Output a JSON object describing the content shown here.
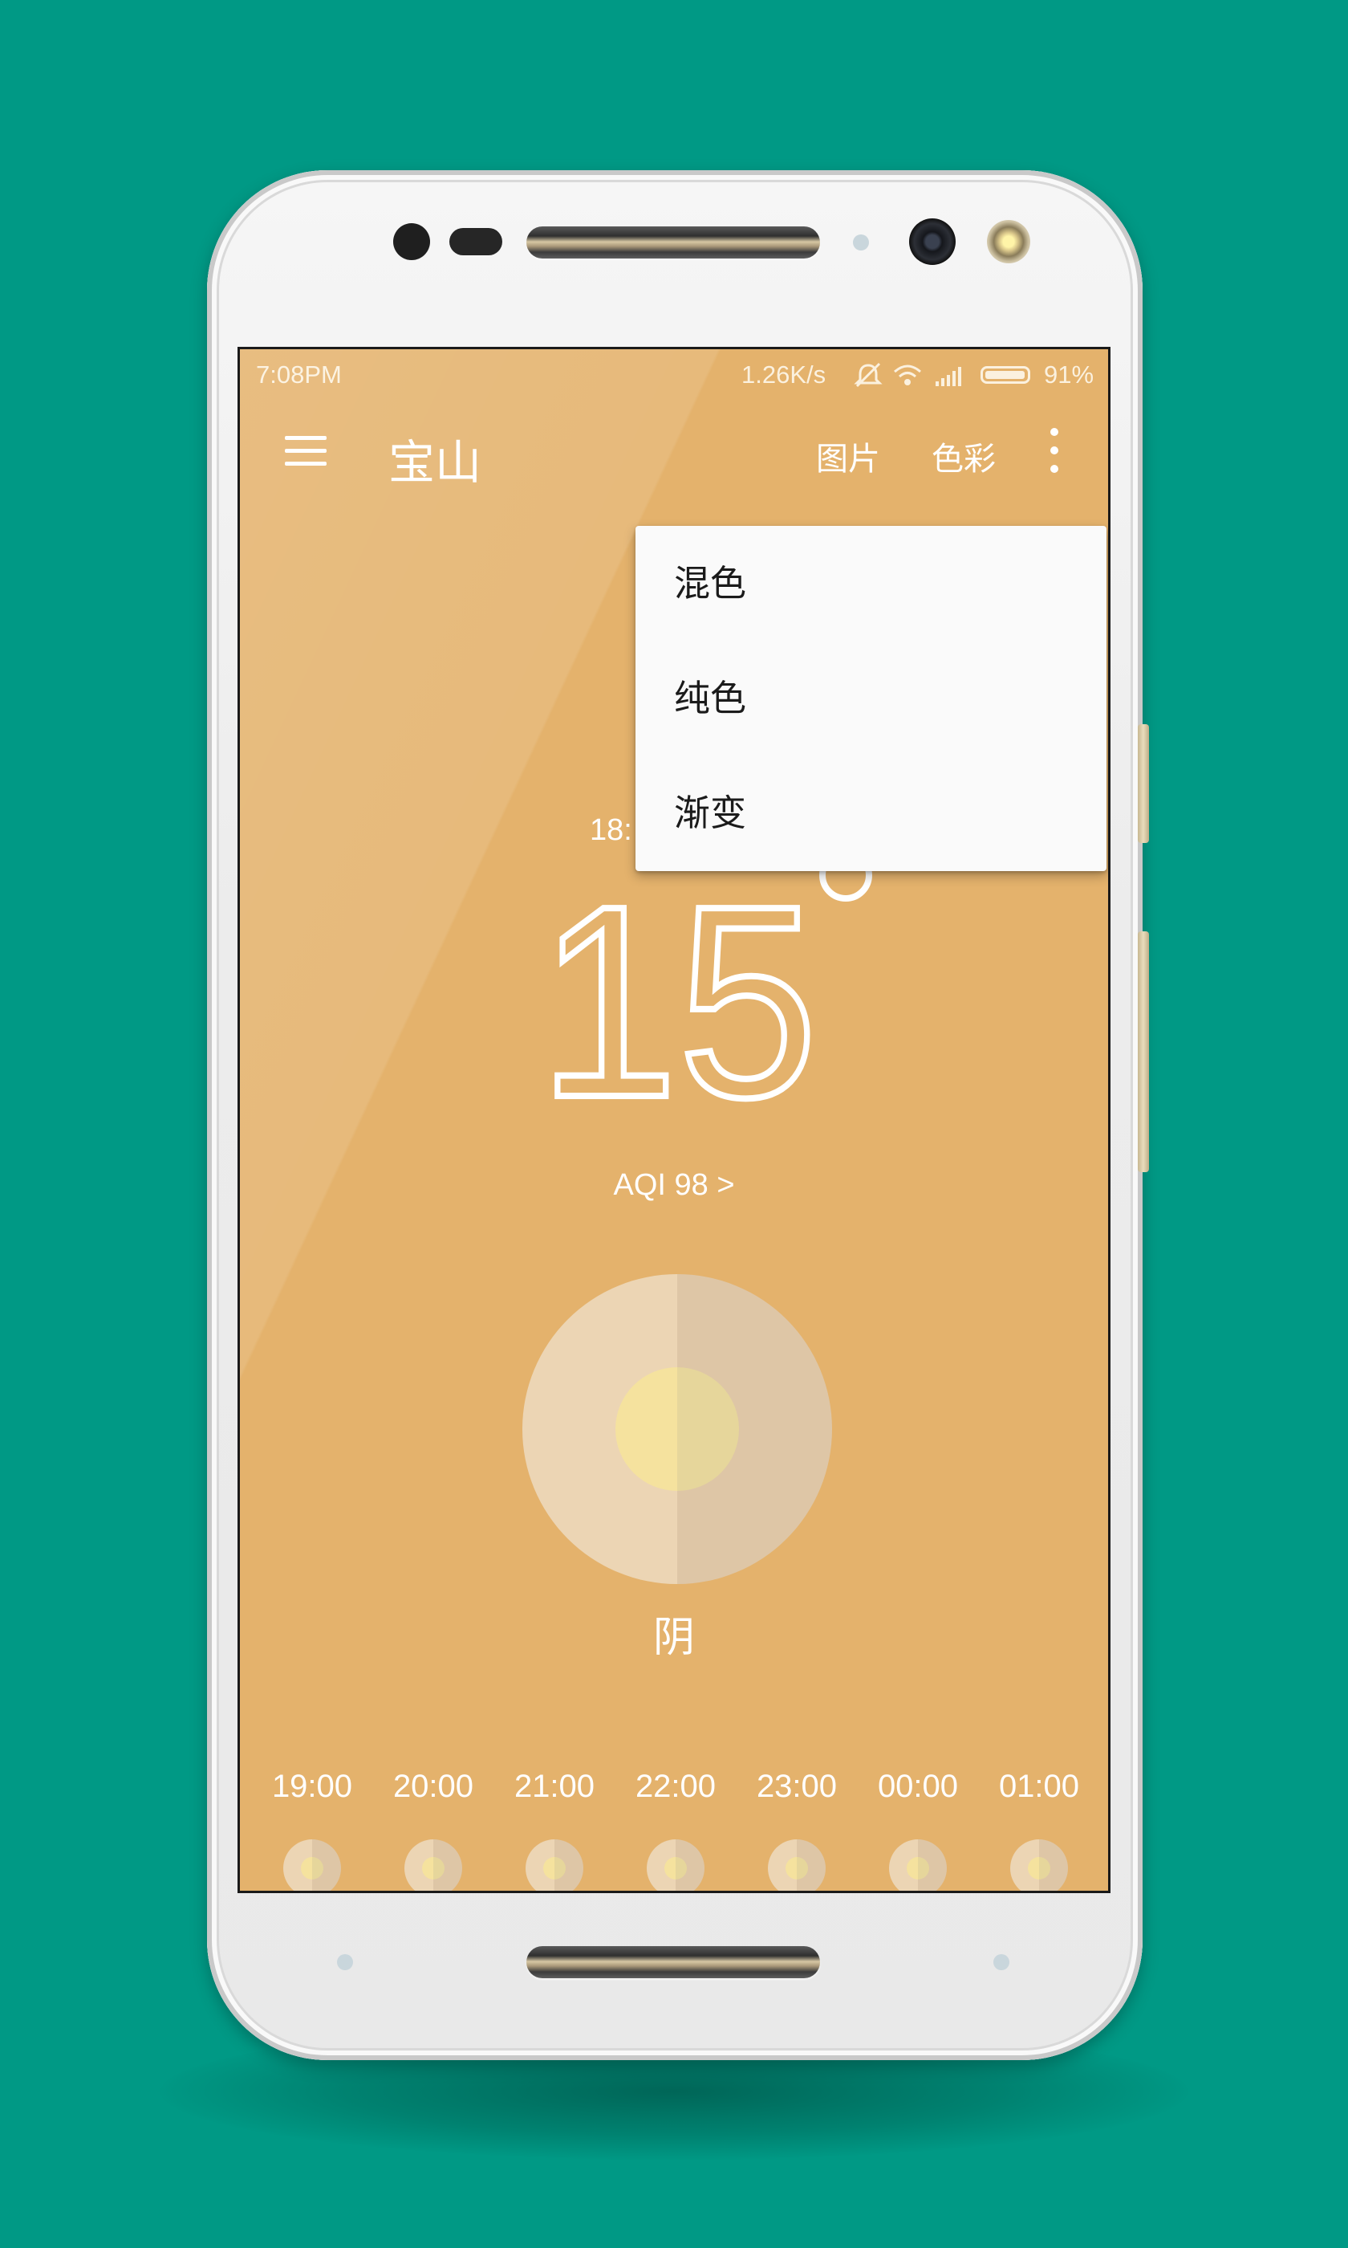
{
  "status_bar": {
    "time": "7:08PM",
    "network_speed": "1.26K/s",
    "icons": [
      "mute-icon",
      "wifi-icon",
      "signal-icon",
      "battery-icon"
    ],
    "battery_percent": "91%",
    "battery_level": 0.91
  },
  "app_bar": {
    "title": "宝山",
    "actions": [
      "图片",
      "色彩"
    ],
    "menu_icon": "hamburger-icon",
    "overflow_icon": "more-vert-icon"
  },
  "popup_menu": {
    "items": [
      "混色",
      "纯色",
      "渐变"
    ]
  },
  "weather": {
    "time_partial": "18:",
    "temperature": "15",
    "degree_symbol": "°",
    "aqi": "AQI 98 >",
    "condition": "阴",
    "icon": "overcast-sun-icon"
  },
  "hourly": [
    {
      "time": "19:00",
      "icon": "overcast-sun-icon"
    },
    {
      "time": "20:00",
      "icon": "overcast-sun-icon"
    },
    {
      "time": "21:00",
      "icon": "overcast-sun-icon"
    },
    {
      "time": "22:00",
      "icon": "overcast-sun-icon"
    },
    {
      "time": "23:00",
      "icon": "overcast-sun-icon"
    },
    {
      "time": "00:00",
      "icon": "overcast-sun-icon"
    },
    {
      "time": "01:00",
      "icon": "overcast-sun-icon"
    }
  ],
  "colors": {
    "background": "#009985",
    "screen": "#e4b26c",
    "menu_bg": "#fafafa",
    "icon_outer_left": "#ecd5b4",
    "icon_outer_right": "#dec6a6",
    "icon_inner": "#f5e29e"
  }
}
